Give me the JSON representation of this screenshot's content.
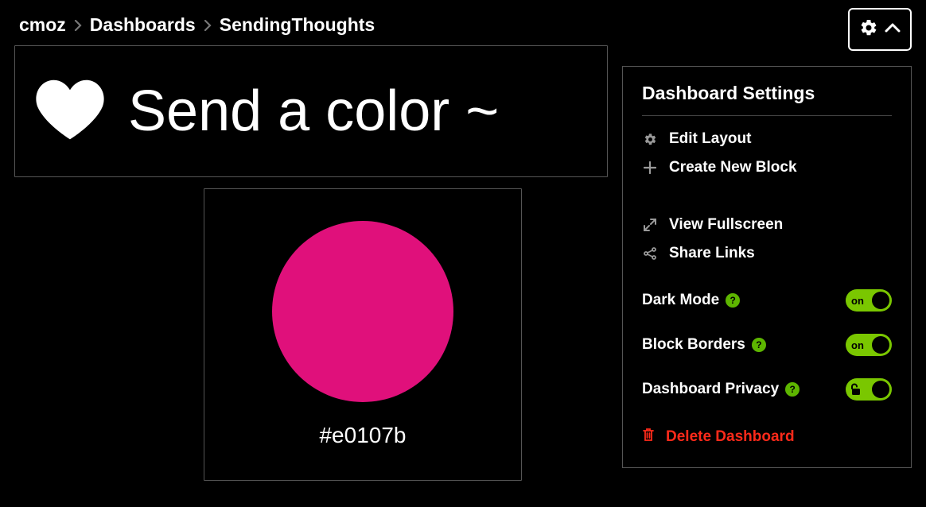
{
  "breadcrumb": {
    "items": [
      "cmoz",
      "Dashboards",
      "SendingThoughts"
    ]
  },
  "title_block": {
    "text": "Send a color ~"
  },
  "color_block": {
    "hex": "#e0107b"
  },
  "settings": {
    "title": "Dashboard Settings",
    "edit_layout": "Edit Layout",
    "create_block": "Create New Block",
    "view_fullscreen": "View Fullscreen",
    "share_links": "Share Links",
    "dark_mode_label": "Dark Mode",
    "block_borders_label": "Block Borders",
    "privacy_label": "Dashboard Privacy",
    "delete_label": "Delete Dashboard",
    "toggle_on_text": "on",
    "help_char": "?"
  },
  "colors": {
    "accent_green": "#7ac700",
    "delete_red": "#ff2a1a",
    "circle": "#e0107b"
  }
}
